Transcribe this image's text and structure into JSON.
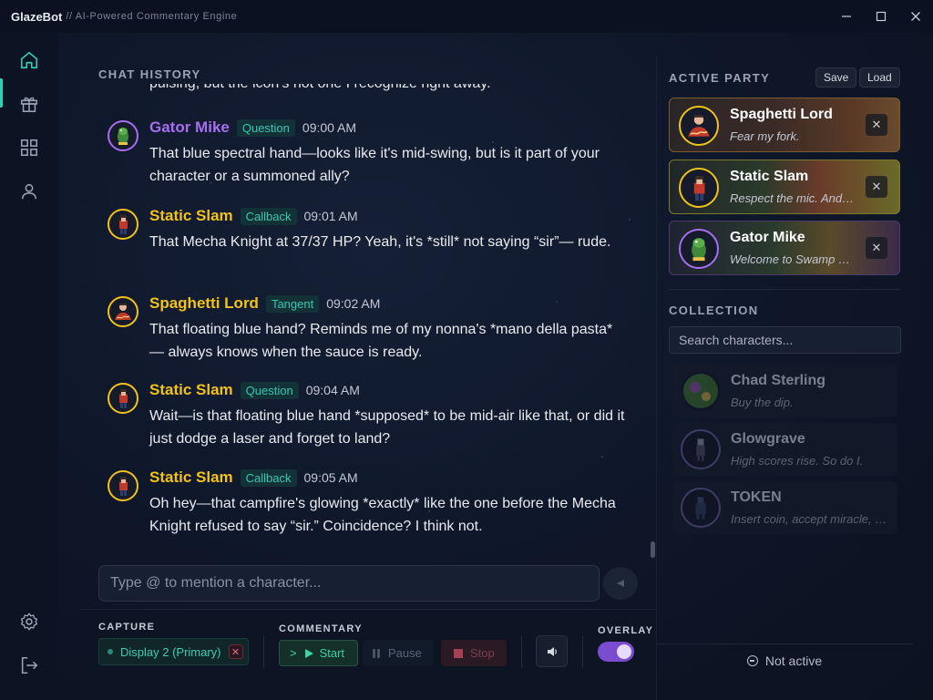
{
  "app": {
    "name": "GlazeBot",
    "tagline": "// AI-Powered Commentary Engine"
  },
  "window_controls": {
    "minimize": "—",
    "maximize": "☐",
    "close": "✕"
  },
  "nav": {
    "items": [
      {
        "name": "home",
        "icon": "home-icon",
        "active": true
      },
      {
        "name": "gifts",
        "icon": "gift-icon",
        "active": false
      },
      {
        "name": "grid",
        "icon": "grid-icon",
        "active": false
      },
      {
        "name": "profile",
        "icon": "user-icon",
        "active": false
      }
    ],
    "bottom": [
      {
        "name": "settings",
        "icon": "gear-icon"
      },
      {
        "name": "logout",
        "icon": "logout-icon"
      }
    ]
  },
  "chat": {
    "title": "CHAT HISTORY",
    "cut_off_text": "pulsing, but the icon's not one I recognize right away.",
    "messages": [
      {
        "author": "Gator Mike",
        "author_color": "#a66ef0",
        "tag": "Question",
        "time": "09:00 AM",
        "text": "That blue spectral hand—looks like it's mid-swing, but is it part of your character or a summoned ally?"
      },
      {
        "author": "Static Slam",
        "author_color": "#f2c21c",
        "tag": "Callback",
        "time": "09:01 AM",
        "text": "That Mecha Knight at 37/37 HP? Yeah, it's *still* not saying “sir”— rude."
      },
      {
        "author": "Spaghetti Lord",
        "author_color": "#f2c21c",
        "tag": "Tangent",
        "time": "09:02 AM",
        "text": "That floating blue hand? Reminds me of my nonna's *mano della pasta* — always knows when the sauce is ready."
      },
      {
        "author": "Static Slam",
        "author_color": "#f2c21c",
        "tag": "Question",
        "time": "09:04 AM",
        "text": "Wait—is that floating blue hand *supposed* to be mid-air like that, or did it just dodge a laser and forget to land?"
      },
      {
        "author": "Static Slam",
        "author_color": "#f2c21c",
        "tag": "Callback",
        "time": "09:05 AM",
        "text": "Oh hey—that campfire's glowing *exactly* like the one before the Mecha Knight refused to say “sir.” Coincidence? I think not."
      }
    ],
    "input_placeholder": "Type @ to mention a character...",
    "send_icon": "send-icon"
  },
  "controls": {
    "capture_label": "CAPTURE",
    "capture_value": "Display 2 (Primary)",
    "capture_remove": "✕",
    "commentary_label": "COMMENTARY",
    "start_prefix": ">",
    "start_label": "Start",
    "pause_label": "Pause",
    "stop_label": "Stop",
    "volume_icon": "speaker-icon",
    "overlay_label": "OVERLAY",
    "overlay_on": true,
    "accent": "#7b4bd0"
  },
  "party": {
    "title": "ACTIVE PARTY",
    "save_label": "Save",
    "load_label": "Load",
    "members": [
      {
        "name": "Spaghetti Lord",
        "quote": "Fear my fork.",
        "ring": "#f2c21c",
        "remove": "✕"
      },
      {
        "name": "Static Slam",
        "quote": "Respect the mic. And the mic respects you.",
        "ring": "#f2c21c",
        "remove": "✕"
      },
      {
        "name": "Gator Mike",
        "quote": "Welcome to Swamp Town, pal.",
        "ring": "#a66ef0",
        "remove": "✕"
      }
    ]
  },
  "collection": {
    "title": "COLLECTION",
    "search_placeholder": "Search characters...",
    "items": [
      {
        "name": "Chad Sterling",
        "quote": "Buy the dip."
      },
      {
        "name": "Glowgrave",
        "quote": "High scores rise. So do I."
      },
      {
        "name": "TOKEN",
        "quote": "Insert coin, accept miracle, be blessed."
      }
    ]
  },
  "status": {
    "text": "Not active"
  }
}
